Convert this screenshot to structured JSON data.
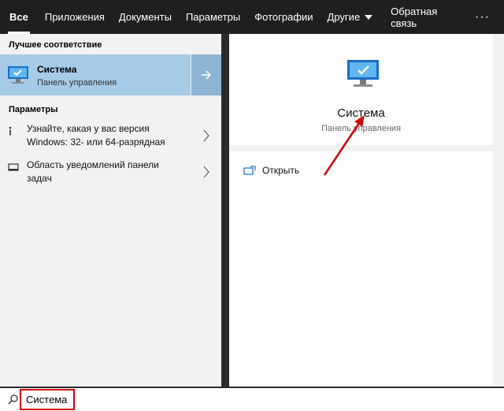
{
  "tabs": [
    {
      "label": "Все",
      "active": true
    },
    {
      "label": "Приложения"
    },
    {
      "label": "Документы"
    },
    {
      "label": "Параметры"
    },
    {
      "label": "Фотографии"
    },
    {
      "label": "Другие",
      "has_dropdown": true
    }
  ],
  "header": {
    "feedback": "Обратная связь",
    "more": "···"
  },
  "left": {
    "best_match_heading": "Лучшее соответствие",
    "best_match": {
      "title": "Система",
      "subtitle": "Панель управления",
      "icon": "computer-monitor-icon"
    },
    "params_heading": "Параметры",
    "items": [
      {
        "text": "Узнайте, какая у вас версия Windows: 32- или 64-разрядная",
        "icon": "info-icon"
      },
      {
        "text": "Область уведомлений панели задач",
        "icon": "taskbar-icon"
      }
    ]
  },
  "right": {
    "title": "Система",
    "subtitle": "Панель управления",
    "open_label": "Открыть",
    "icon": "computer-monitor-icon"
  },
  "search": {
    "value": "Система",
    "icon": "search-icon"
  },
  "colors": {
    "accent": "#a6cbe7",
    "annotation": "#d00000",
    "bar": "#1f1f1f"
  }
}
